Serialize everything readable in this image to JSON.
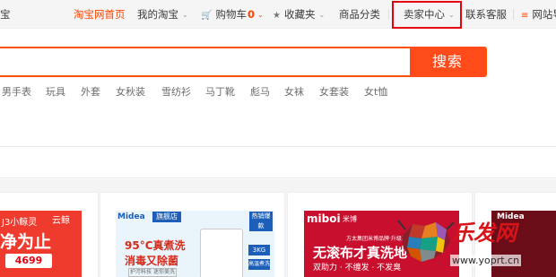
{
  "topbar": {
    "left_text": "宝",
    "home": "淘宝网首页",
    "my_taobao": "我的淘宝",
    "cart_label": "购物车",
    "cart_count": "0",
    "favorites": "收藏夹",
    "categories": "商品分类",
    "seller_center": "卖家中心",
    "customer_service": "联系客服",
    "site_nav": "网站导"
  },
  "search": {
    "button_label": "搜索",
    "value": "",
    "hotwords": [
      "男手表",
      "玩具",
      "外套",
      "女秋装",
      "雪纺衫",
      "马丁靴",
      "彪马",
      "女袜",
      "女套装",
      "女t恤"
    ]
  },
  "promos": [
    {
      "title": "J3小鲸灵",
      "brand": "云鲸",
      "headline": "净为止",
      "price": "4699"
    },
    {
      "brand": "Midea",
      "tag": "旗舰店",
      "hot": "热销爆款",
      "line1": "95°C真煮洗",
      "line2": "消毒又除菌",
      "small": "护污科技 迷你美洗",
      "kg": "3KG",
      "kg2": "高温煮洗"
    },
    {
      "brand": "miboi",
      "brand2": "米博",
      "sub": "方太集团米博品牌·升级款V5A",
      "line1": "无滚布才真洗地",
      "line2": "双助力 · 不缠发 · 不发臭"
    },
    {
      "brand": "Midea"
    }
  ],
  "watermark": {
    "logo": "乐发网",
    "url": "www.yoprt.cn"
  },
  "colors": {
    "accent": "#ff4400",
    "search_border": "#ff5000",
    "highlight_box": "#e4000f"
  }
}
